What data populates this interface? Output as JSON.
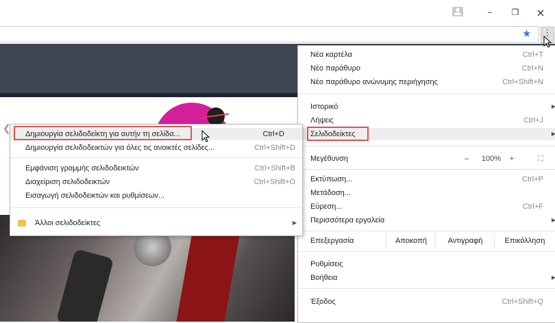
{
  "window": {
    "minimize": "–",
    "restore": "❐",
    "close": "×"
  },
  "toolbar": {
    "star_icon": "★",
    "menu_icon": "⋮"
  },
  "main_menu": {
    "new_tab": {
      "label": "Νέα καρτέλα",
      "shortcut": "Ctrl+T"
    },
    "new_window": {
      "label": "Νέο παράθυρο",
      "shortcut": "Ctrl+N"
    },
    "incognito": {
      "label": "Νέο παράθυρο ανώνυμης περιήγησης",
      "shortcut": "Ctrl+Shift+N"
    },
    "history": {
      "label": "Ιστορικό"
    },
    "downloads": {
      "label": "Λήψεις",
      "shortcut": "Ctrl+J"
    },
    "bookmarks": {
      "label": "Σελιδοδείκτες"
    },
    "zoom": {
      "label": "Μεγέθυνση",
      "minus": "–",
      "value": "100%",
      "plus": "+",
      "fullscreen": "⛶"
    },
    "print": {
      "label": "Εκτύπωση...",
      "shortcut": "Ctrl+P"
    },
    "cast": {
      "label": "Μετάδοση..."
    },
    "find": {
      "label": "Εύρεση...",
      "shortcut": "Ctrl+F"
    },
    "more_tools": {
      "label": "Περισσότερα εργαλεία"
    },
    "edit": {
      "label": "Επεξεργασία",
      "cut": "Αποκοπή",
      "copy": "Αντιγραφή",
      "paste": "Επικόλληση"
    },
    "settings": {
      "label": "Ρυθμίσεις"
    },
    "help": {
      "label": "Βοήθεια"
    },
    "exit": {
      "label": "Έξοδος",
      "shortcut": "Ctrl+Shift+Q"
    }
  },
  "bookmarks_submenu": {
    "bookmark_page": {
      "label": "Δημιουργία σελιδοδείκτη για αυτήν τη σελίδα...",
      "shortcut": "Ctrl+D"
    },
    "bookmark_all": {
      "label": "Δημιουργία σελιδοδεικτών για όλες τις ανοικτές σελίδες...",
      "shortcut": "Ctrl+Shift+D"
    },
    "show_bar": {
      "label": "Εμφάνιση γραμμής σελιδοδεικτών",
      "shortcut": "Ctrl+Shift+B"
    },
    "manager": {
      "label": "Διαχείριση σελιδοδεικτών",
      "shortcut": "Ctrl+Shift+O"
    },
    "import": {
      "label": "Εισαγωγή σελιδοδεικτών και ρυθμίσεων..."
    },
    "other": {
      "label": "Άλλοι σελιδοδείκτες"
    }
  },
  "colors": {
    "highlight_border": "#e35050",
    "accent_star": "#3b78e7",
    "header_band": "#3e4653"
  }
}
